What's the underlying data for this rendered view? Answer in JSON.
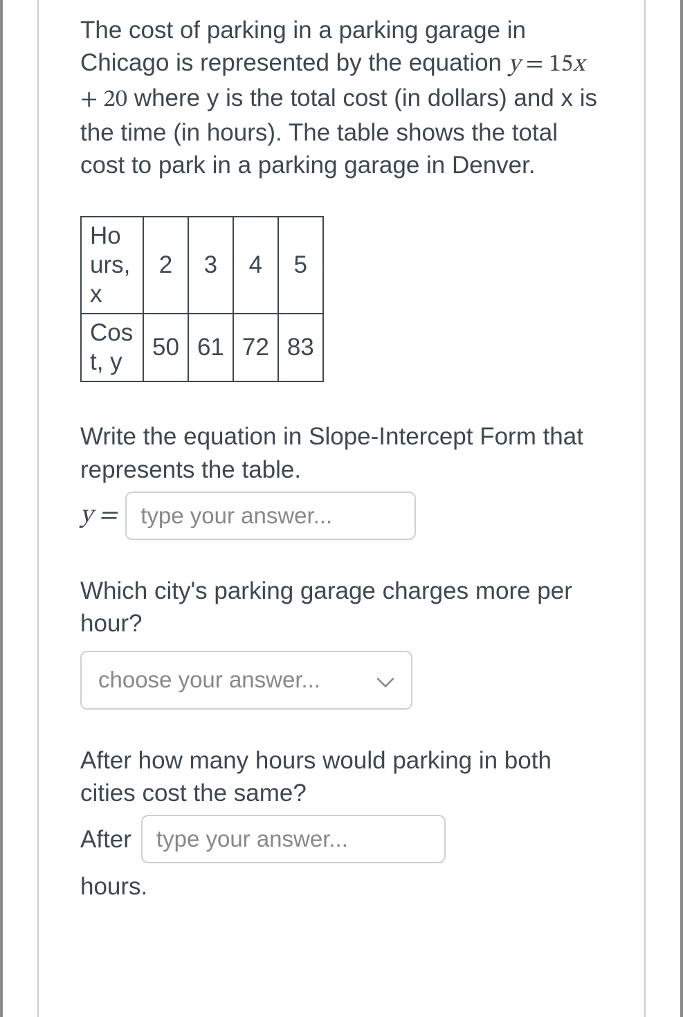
{
  "problem": {
    "text_part1": "The cost of parking in a parking garage in Chicago is represented by the equation ",
    "equation_lhs": "y",
    "equation_eq": " = ",
    "equation_rhs": "15x + 20",
    "text_part2": "  where y is the total cost (in dollars) and x is the time (in hours).  The table shows the total cost to park in a parking garage in Denver."
  },
  "table": {
    "row1_header": "Hours, x",
    "row1_values": [
      "2",
      "3",
      "4",
      "5"
    ],
    "row2_header": "Cost, y",
    "row2_values": [
      "50",
      "61",
      "72",
      "83"
    ]
  },
  "q1": {
    "prompt": "Write the equation in Slope-Intercept Form that represents the table.",
    "prefix": "y = ",
    "placeholder": "type your answer..."
  },
  "q2": {
    "prompt": "Which city's parking garage charges more per hour?",
    "placeholder": "choose your answer..."
  },
  "q3": {
    "prompt": "After how many hours would parking in both cities cost the same?",
    "prefix": "After",
    "placeholder": "type your answer...",
    "suffix": "hours."
  }
}
